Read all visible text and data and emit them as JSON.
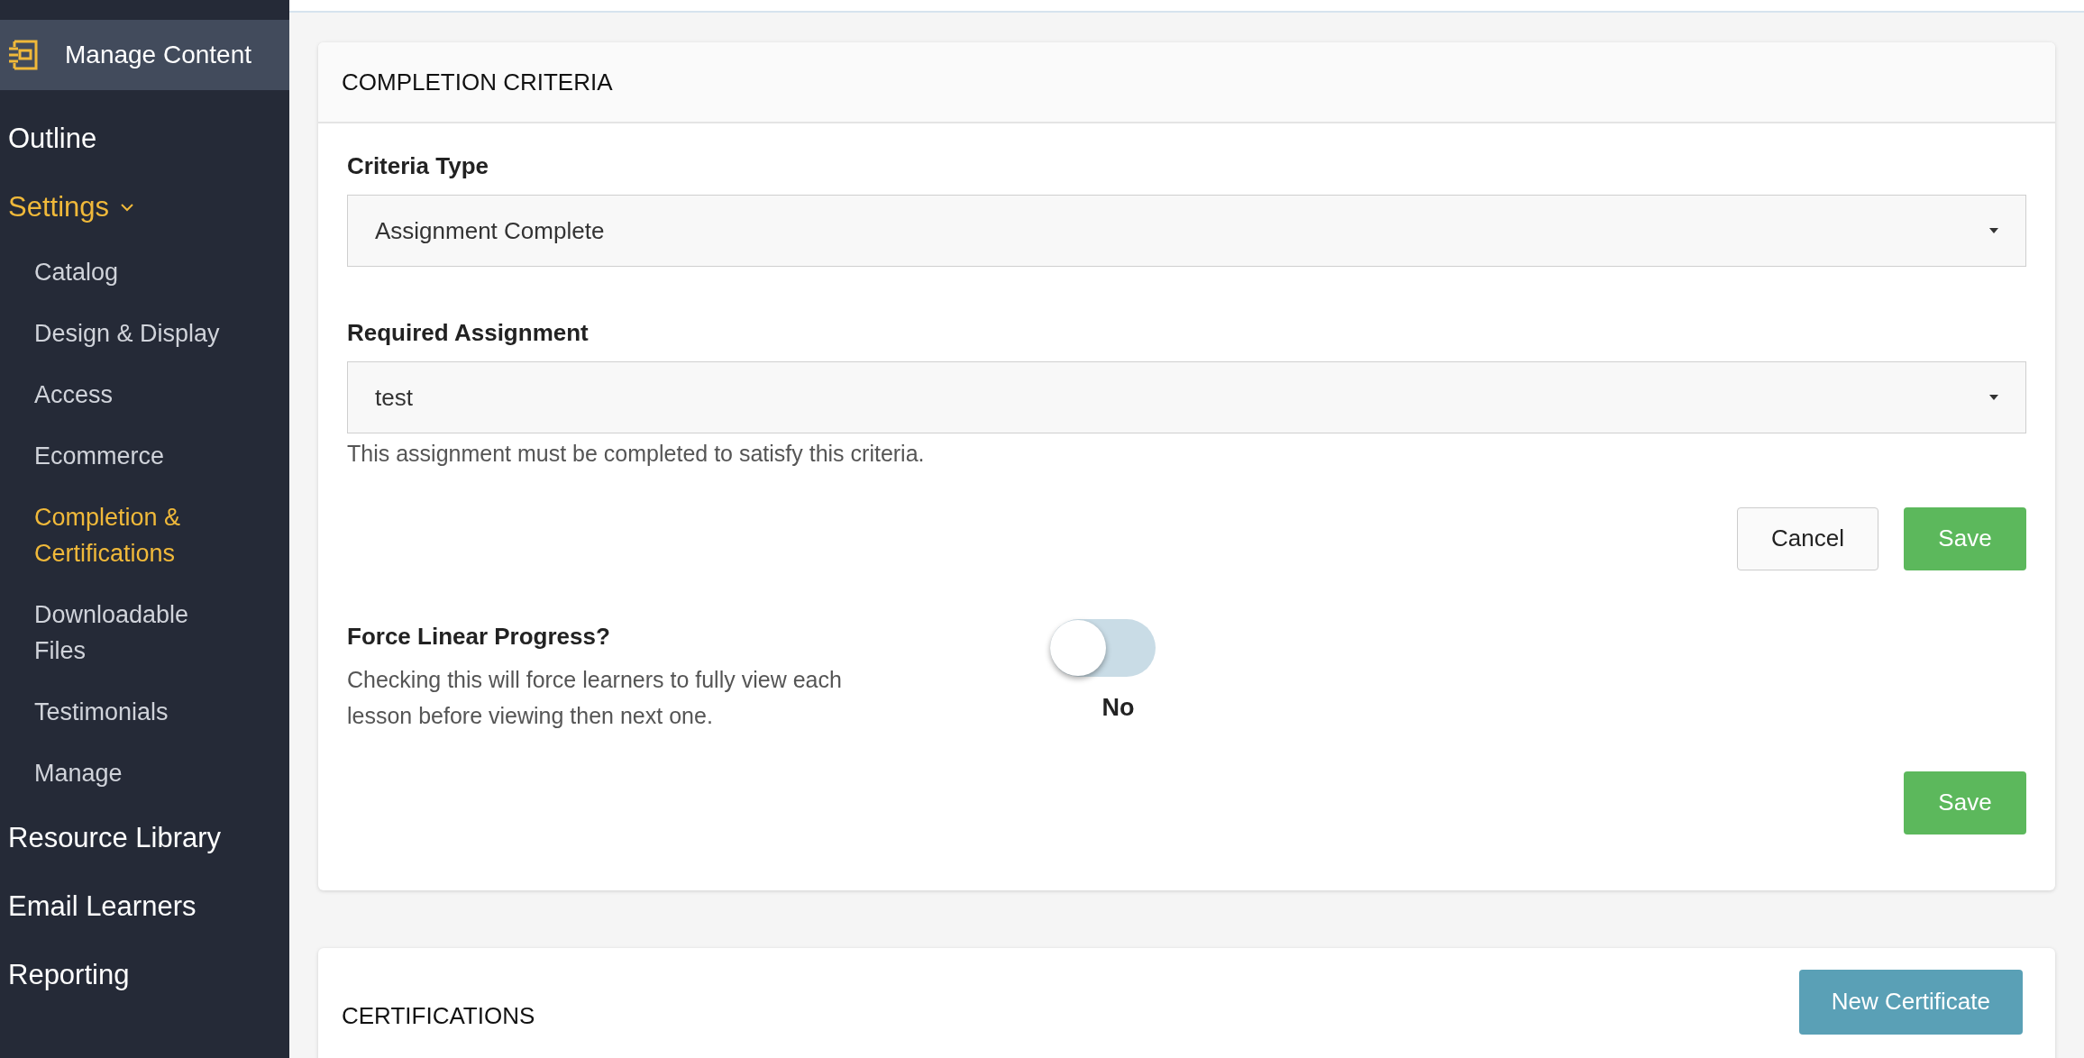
{
  "sidebar": {
    "header": {
      "label": "Manage Content",
      "selected": true
    },
    "items": [
      {
        "label": "Outline",
        "selected": false
      },
      {
        "label": "Settings",
        "selected": true,
        "expanded": true,
        "children": [
          {
            "label": "Catalog",
            "selected": false
          },
          {
            "label": "Design & Display",
            "selected": false
          },
          {
            "label": "Access",
            "selected": false
          },
          {
            "label": "Ecommerce",
            "selected": false
          },
          {
            "label": "Completion & Certifications",
            "selected": true
          },
          {
            "label": "Downloadable Files",
            "selected": false
          },
          {
            "label": "Testimonials",
            "selected": false
          },
          {
            "label": "Manage",
            "selected": false
          }
        ]
      },
      {
        "label": "Resource Library",
        "selected": false
      },
      {
        "label": "Email Learners",
        "selected": false
      },
      {
        "label": "Reporting",
        "selected": false
      }
    ]
  },
  "completion_criteria": {
    "title": "COMPLETION CRITERIA",
    "criteria_type": {
      "label": "Criteria Type",
      "value": "Assignment Complete"
    },
    "required_assignment": {
      "label": "Required Assignment",
      "value": "test",
      "help": "This assignment must be completed to satisfy this criteria."
    },
    "buttons": {
      "cancel": "Cancel",
      "save": "Save"
    },
    "force_linear": {
      "label": "Force Linear Progress?",
      "description": "Checking this will force learners to fully view each lesson before viewing then next one.",
      "on": false,
      "state_label": "No"
    },
    "save": "Save"
  },
  "certifications": {
    "title": "CERTIFICATIONS",
    "button": "New Certificate"
  }
}
